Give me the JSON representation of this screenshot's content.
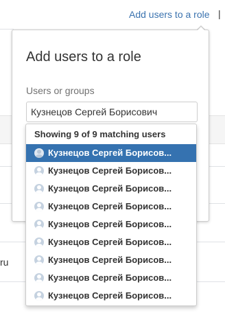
{
  "page": {
    "header_link": "Add users to a role",
    "separator": "|",
    "background_cell_text": "ru"
  },
  "dialog": {
    "title": "Add users to a role",
    "field_label": "Users or groups",
    "input_value": "Кузнецов Сергей Борисович"
  },
  "suggestions": {
    "header": "Showing 9 of 9 matching users",
    "selected_index": 0,
    "items": [
      {
        "label": "Кузнецов Сергей Борисов..."
      },
      {
        "label": "Кузнецов Сергей Борисов..."
      },
      {
        "label": "Кузнецов Сергей Борисов..."
      },
      {
        "label": "Кузнецов Сергей Борисов..."
      },
      {
        "label": "Кузнецов Сергей Борисов..."
      },
      {
        "label": "Кузнецов Сергей Борисов..."
      },
      {
        "label": "Кузнецов Сергей Борисов..."
      },
      {
        "label": "Кузнецов Сергей Борисов..."
      },
      {
        "label": "Кузнецов Сергей Борисов..."
      }
    ]
  },
  "colors": {
    "link": "#3b73af",
    "selected_row": "#3572b0",
    "border": "#cccccc"
  },
  "icons": {
    "user_avatar": "user-avatar-icon"
  }
}
